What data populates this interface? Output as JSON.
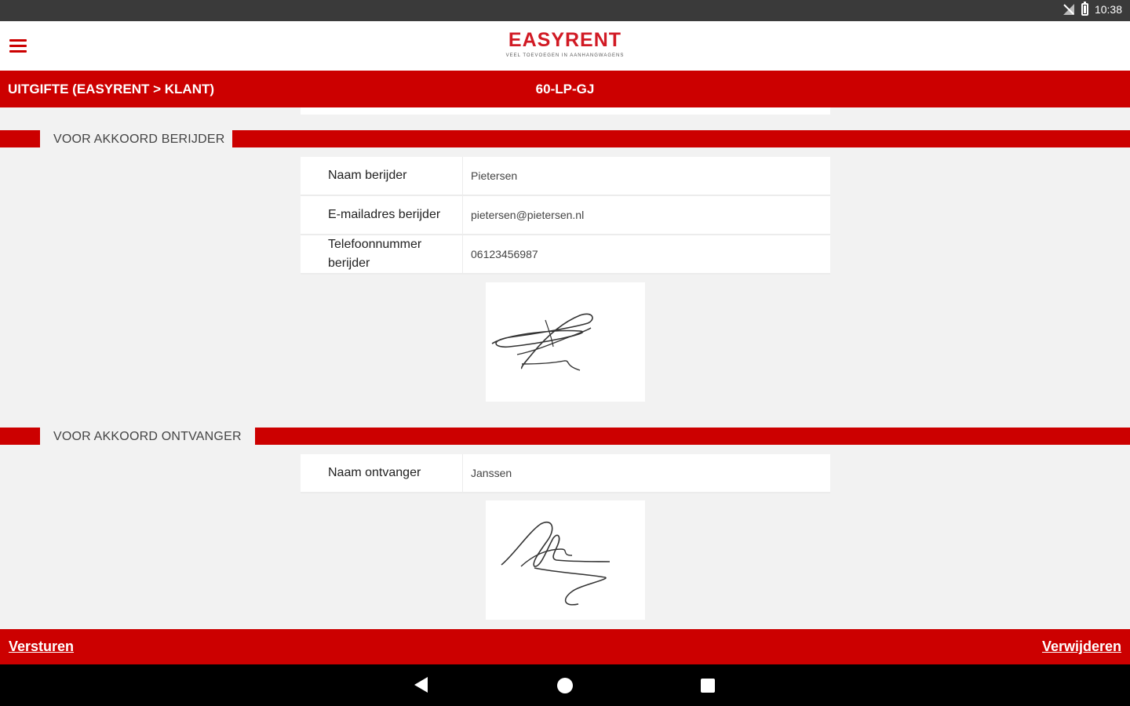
{
  "status_bar": {
    "time": "10:38"
  },
  "app": {
    "brand": "EASYRENT",
    "tagline": "veel toevoegen in aanhangwagens"
  },
  "title_bar": {
    "left": "UITGIFTE (EASYRENT > KLANT)",
    "center": "60-LP-GJ"
  },
  "section_driver": {
    "header": "VOOR AKKOORD BERIJDER",
    "rows": [
      {
        "label": "Naam berijder",
        "value": "Pietersen"
      },
      {
        "label": "E-mailadres berijder",
        "value": "pietersen@pietersen.nl"
      },
      {
        "label": "Telefoonnummer berijder",
        "value": "06123456987"
      }
    ]
  },
  "section_receiver": {
    "header": "VOOR AKKOORD ONTVANGER",
    "rows": [
      {
        "label": "Naam ontvanger",
        "value": "Janssen"
      }
    ]
  },
  "bottom_bar": {
    "send": "Versturen",
    "delete": "Verwijderen"
  },
  "colors": {
    "brand_red": "#cc0000",
    "logo_red": "#d11a24"
  }
}
